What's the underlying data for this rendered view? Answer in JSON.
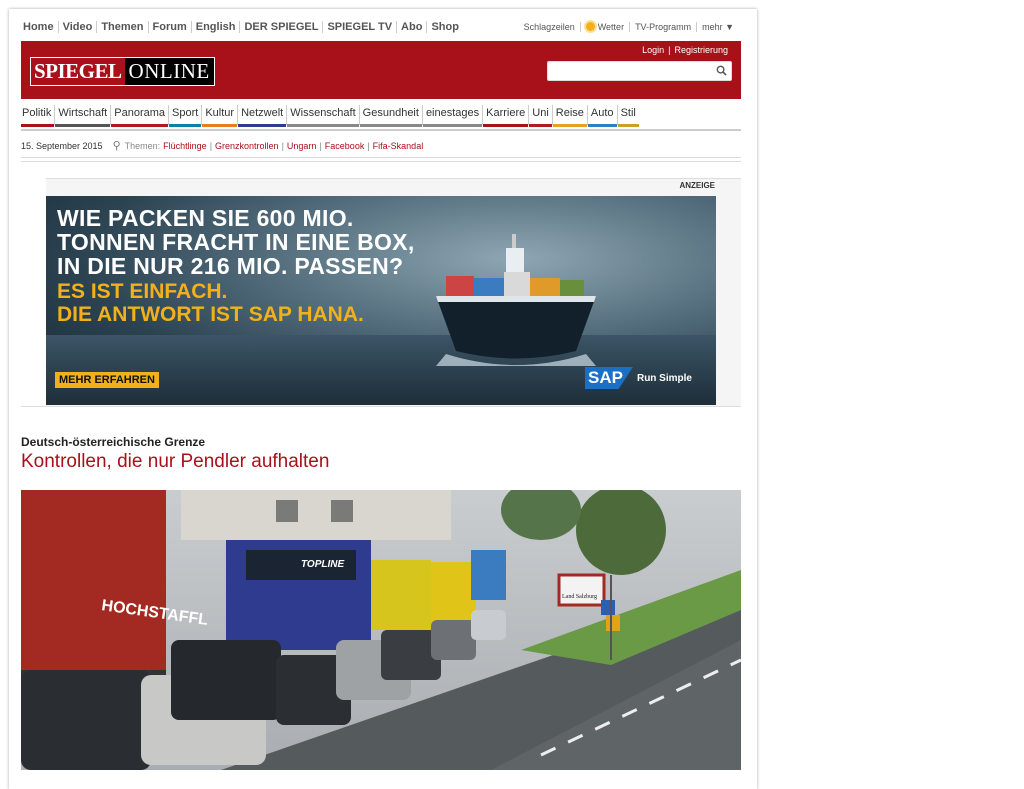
{
  "topnav": [
    "Home",
    "Video",
    "Themen",
    "Forum",
    "English",
    "DER SPIEGEL",
    "SPIEGEL TV",
    "Abo",
    "Shop"
  ],
  "toplinks": {
    "schlagzeilen": "Schlagzeilen",
    "wetter": "Wetter",
    "tv": "TV-Programm",
    "mehr": "mehr ▼"
  },
  "logo": {
    "part1": "SPIEGEL",
    "part2": "ONLINE"
  },
  "auth": {
    "login": "Login",
    "sep": "|",
    "register": "Registrierung"
  },
  "search": {
    "placeholder": ""
  },
  "sections": [
    {
      "label": "Politik",
      "color": "#a8101a"
    },
    {
      "label": "Wirtschaft",
      "color": "#555555"
    },
    {
      "label": "Panorama",
      "color": "#b51824"
    },
    {
      "label": "Sport",
      "color": "#0f7fa6"
    },
    {
      "label": "Kultur",
      "color": "#e67e22"
    },
    {
      "label": "Netzwelt",
      "color": "#2c3e8f"
    },
    {
      "label": "Wissenschaft",
      "color": "#888888"
    },
    {
      "label": "Gesundheit",
      "color": "#888888"
    },
    {
      "label": "einestages",
      "color": "#888888"
    },
    {
      "label": "Karriere",
      "color": "#a8101a"
    },
    {
      "label": "Uni",
      "color": "#b51824"
    },
    {
      "label": "Reise",
      "color": "#e6a220"
    },
    {
      "label": "Auto",
      "color": "#2b7fc7"
    },
    {
      "label": "Stil",
      "color": "#c9a227"
    }
  ],
  "datebar": {
    "date": "15. September 2015",
    "themes_label": "Themen:",
    "topics": [
      "Flüchtlinge",
      "Grenzkontrollen",
      "Ungarn",
      "Facebook",
      "Fifa-Skandal"
    ]
  },
  "ad": {
    "anzeige": "ANZEIGE",
    "headline": [
      "WIE PACKEN SIE 600 MIO.",
      "TONNEN FRACHT IN EINE BOX,",
      "IN DIE NUR 216 MIO. PASSEN?"
    ],
    "subline": [
      "ES IST EINFACH.",
      "DIE ANTWORT IST SAP HANA."
    ],
    "cta": "MEHR ERFAHREN",
    "brand": "SAP",
    "slogan": "Run Simple"
  },
  "article": {
    "kicker": "Deutsch-österreichische Grenze",
    "headline": "Kontrollen, die nur Pendler aufhalten"
  },
  "photo": {
    "truck_text": "TOPLINE",
    "sign_text": "Land Salzburg",
    "trailer_text": "HOCHSTAFFL"
  },
  "colors": {
    "brand_red": "#a8101a",
    "ad_yellow": "#f2b11b",
    "sap_blue": "#1b6fc4"
  }
}
